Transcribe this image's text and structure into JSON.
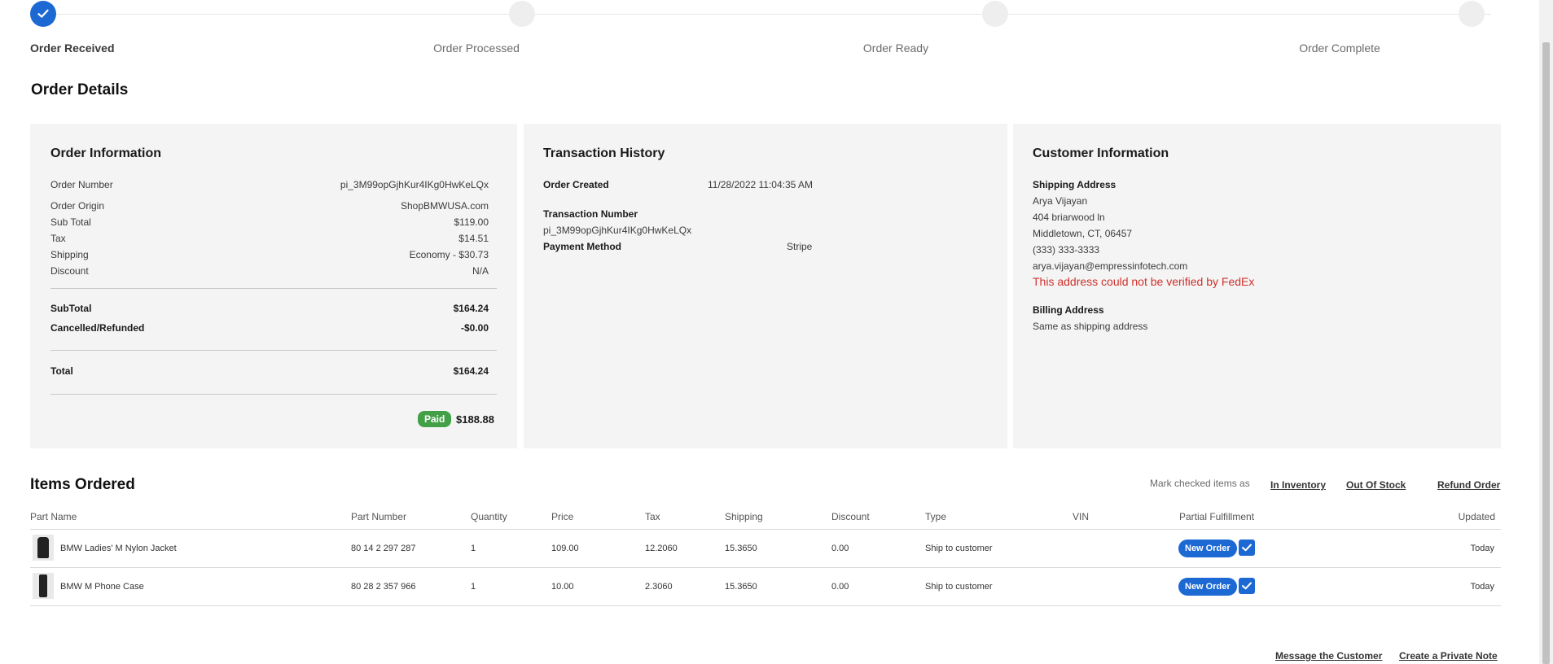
{
  "stepper": {
    "steps": [
      {
        "label": "Order Received",
        "status": "complete"
      },
      {
        "label": "Order Processed",
        "status": "pending"
      },
      {
        "label": "Order Ready",
        "status": "pending"
      },
      {
        "label": "Order Complete",
        "status": "pending"
      }
    ]
  },
  "page_title": "Order Details",
  "order_info": {
    "title": "Order Information",
    "fields": [
      {
        "label": "Order Number",
        "value": "pi_3M99opGjhKur4IKg0HwKeLQx"
      },
      {
        "label": "Order Origin",
        "value": "ShopBMWUSA.com"
      },
      {
        "label": "Sub Total",
        "value": "$119.00"
      },
      {
        "label": "Tax",
        "value": "$14.51"
      },
      {
        "label": "Shipping",
        "value": "Economy - $30.73"
      },
      {
        "label": "Discount",
        "value": "N/A"
      }
    ],
    "subtotal_label": "SubTotal",
    "subtotal_value": "$164.24",
    "refunded_label": "Cancelled/Refunded",
    "refunded_value": "-$0.00",
    "total_label": "Total",
    "total_value": "$164.24",
    "paid_badge": "Paid",
    "paid_amount": "$188.88"
  },
  "transaction_history": {
    "title": "Transaction History",
    "order_created_label": "Order Created",
    "order_created_value": "11/28/2022 11:04:35 AM",
    "transaction_number_label": "Transaction Number",
    "transaction_number_value": "pi_3M99opGjhKur4IKg0HwKeLQx",
    "payment_method_label": "Payment Method",
    "payment_method_value": "Stripe"
  },
  "customer_info": {
    "title": "Customer Information",
    "shipping_label": "Shipping Address",
    "name": "Arya Vijayan",
    "street": "404 briarwood ln",
    "city": "Middletown, CT, 06457",
    "phone": "(333) 333-3333",
    "email": "arya.vijayan@empressinfotech.com",
    "warning": "This address could not be verified by FedEx",
    "billing_label": "Billing Address",
    "billing_value": "Same as shipping address"
  },
  "items": {
    "title": "Items Ordered",
    "mark_label": "Mark checked items as",
    "in_inventory": "In Inventory",
    "out_of_stock": "Out Of Stock",
    "refund_order": "Refund Order",
    "headers": {
      "part_name": "Part Name",
      "part_number": "Part Number",
      "quantity": "Quantity",
      "price": "Price",
      "tax": "Tax",
      "shipping": "Shipping",
      "discount": "Discount",
      "type": "Type",
      "vin": "VIN",
      "partial": "Partial Fulfillment",
      "updated": "Updated"
    },
    "rows": [
      {
        "name": "BMW Ladies' M Nylon Jacket",
        "part_number": "80 14 2 297 287",
        "quantity": "1",
        "price": "109.00",
        "tax": "12.2060",
        "shipping": "15.3650",
        "discount": "0.00",
        "type": "Ship to customer",
        "vin": "",
        "status": "New Order",
        "checked": true,
        "updated": "Today"
      },
      {
        "name": "BMW M Phone Case",
        "part_number": "80 28 2 357 966",
        "quantity": "1",
        "price": "10.00",
        "tax": "2.3060",
        "shipping": "15.3650",
        "discount": "0.00",
        "type": "Ship to customer",
        "vin": "",
        "status": "New Order",
        "checked": true,
        "updated": "Today"
      }
    ]
  },
  "footer": {
    "message_customer": "Message the Customer",
    "private_note": "Create a Private Note"
  },
  "colors": {
    "accent": "#1c69d4",
    "paid": "#43a047",
    "warning": "#d0302b",
    "panel_bg": "#f4f4f4"
  }
}
